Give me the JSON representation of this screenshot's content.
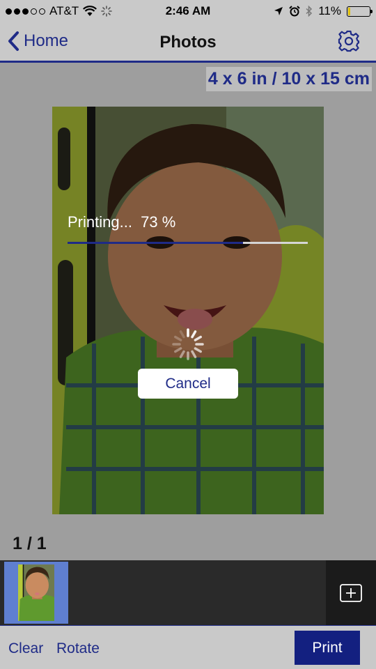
{
  "status_bar": {
    "carrier": "AT&T",
    "time": "2:46 AM",
    "battery": "11%",
    "battery_level": 0.11,
    "icons": [
      "signal-dots-icon",
      "wifi-icon",
      "activity-spinner-icon",
      "location-arrow-icon",
      "alarm-icon",
      "bluetooth-icon",
      "battery-icon"
    ]
  },
  "nav": {
    "back_label": "Home",
    "title": "Photos",
    "settings_icon": "gear-icon"
  },
  "paper_size": "4 x 6 in / 10 x 15 cm",
  "print_progress": {
    "label": "Printing...  73 %",
    "percent": 73
  },
  "cancel_label": "Cancel",
  "page_counter": "1 / 1",
  "thumbnail_strip": {
    "add_icon": "plus-square-icon"
  },
  "toolbar": {
    "clear_label": "Clear",
    "rotate_label": "Rotate",
    "print_label": "Print"
  },
  "colors": {
    "accent": "#1f2b87",
    "print_button": "#132080",
    "bar_bg": "#c9c9c9",
    "content_bg": "#9e9e9e"
  }
}
